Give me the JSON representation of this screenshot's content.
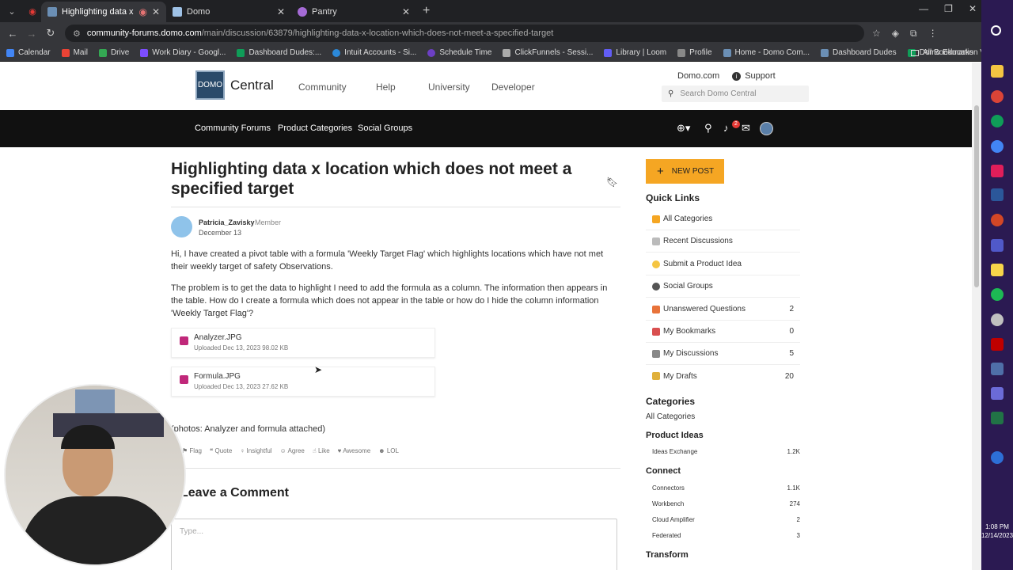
{
  "browser": {
    "tabs": [
      {
        "title": "Highlighting data x locatio",
        "active": true,
        "favicon_color": "#6b8fb5"
      },
      {
        "title": "Domo",
        "active": false,
        "favicon_color": "#9ec1e6"
      },
      {
        "title": "Pantry",
        "active": false,
        "favicon_color": "#a56bd6"
      }
    ],
    "url_host": "community-forums.domo.com",
    "url_path": "/main/discussion/63879/highlighting-data-x-location-which-does-not-meet-a-specified-target",
    "bookmarks": [
      {
        "label": "Calendar",
        "color": "#4285f4"
      },
      {
        "label": "Mail",
        "color": "#ea4335"
      },
      {
        "label": "Drive",
        "color": "#34a853"
      },
      {
        "label": "Work Diary - Googl...",
        "color": "#7c4dff"
      },
      {
        "label": "Dashboard Dudes:...",
        "color": "#0f9d58"
      },
      {
        "label": "Intuit Accounts - Si...",
        "color": "#2b88d8"
      },
      {
        "label": "Schedule Time",
        "color": "#6c3fc4"
      },
      {
        "label": "ClickFunnels - Sessi...",
        "color": "#aaaaaa"
      },
      {
        "label": "Library | Loom",
        "color": "#625df5"
      },
      {
        "label": "Profile",
        "color": "#888888"
      },
      {
        "label": "Home - Domo Com...",
        "color": "#6b8fb5"
      },
      {
        "label": "Dashboard Dudes",
        "color": "#6b8fb5"
      },
      {
        "label": "Domo Education Vi...",
        "color": "#0f9d58"
      }
    ],
    "all_bookmarks": "All Bookmarks"
  },
  "site": {
    "logo_mark": "DOMO",
    "logo_text": "Central",
    "nav": [
      "Community",
      "Help",
      "University",
      "Developer"
    ],
    "top_links": {
      "domo": "Domo.com",
      "support": "Support"
    },
    "search_placeholder": "Search Domo Central",
    "subnav": [
      "Community Forums",
      "Product Categories",
      "Social Groups"
    ],
    "notification_count": "2"
  },
  "post": {
    "title": "Highlighting data x location which does not meet a specified target",
    "author": "Patricia_Zavisky",
    "role": "Member",
    "date": "December 13",
    "para1": "Hi, I have created a pivot table with a formula 'Weekly Target Flag' which highlights locations which have not met their weekly target of safety Observations.",
    "para2": "The problem is to get the data to highlight I need to add the formula as a column. The information then appears in the table. How do I create a formula which does not appear in the table or how do I hide the column information 'Weekly Target Flag'?",
    "attachments": [
      {
        "name": "Analyzer.JPG",
        "meta": "Uploaded Dec 13, 2023   98.02 KB"
      },
      {
        "name": "Formula.JPG",
        "meta": "Uploaded Dec 13, 2023   27.62 KB"
      }
    ],
    "note": "(photos: Analyzer and formula attached)",
    "reactions": [
      "Flag",
      "Quote",
      "Insightful",
      "Agree",
      "Like",
      "Awesome",
      "LOL"
    ],
    "leave_comment": "Leave a Comment",
    "comment_placeholder": "Type..."
  },
  "sidebar": {
    "new_post": "NEW POST",
    "quick_links_title": "Quick Links",
    "quick_links": [
      {
        "label": "All Categories",
        "count": "",
        "color": "#f5a623"
      },
      {
        "label": "Recent Discussions",
        "count": "",
        "color": "#bbbbbb"
      },
      {
        "label": "Submit a Product Idea",
        "count": "",
        "color": "#f5c542"
      },
      {
        "label": "Social Groups",
        "count": "",
        "color": "#555555"
      },
      {
        "label": "Unanswered Questions",
        "count": "2",
        "color": "#e8733a"
      },
      {
        "label": "My Bookmarks",
        "count": "0",
        "color": "#d94f4f"
      },
      {
        "label": "My Discussions",
        "count": "5",
        "color": "#888888"
      },
      {
        "label": "My Drafts",
        "count": "20",
        "color": "#e0b03a"
      }
    ],
    "categories_title": "Categories",
    "all_categories": "All Categories",
    "product_ideas_title": "Product Ideas",
    "product_ideas": [
      {
        "label": "Ideas Exchange",
        "count": "1.2K"
      }
    ],
    "connect_title": "Connect",
    "connect": [
      {
        "label": "Connectors",
        "count": "1.1K"
      },
      {
        "label": "Workbench",
        "count": "274"
      },
      {
        "label": "Cloud Amplifier",
        "count": "2"
      },
      {
        "label": "Federated",
        "count": "3"
      }
    ],
    "transform_title": "Transform"
  },
  "taskbar": {
    "time": "1:08 PM",
    "date": "12/14/2023"
  }
}
